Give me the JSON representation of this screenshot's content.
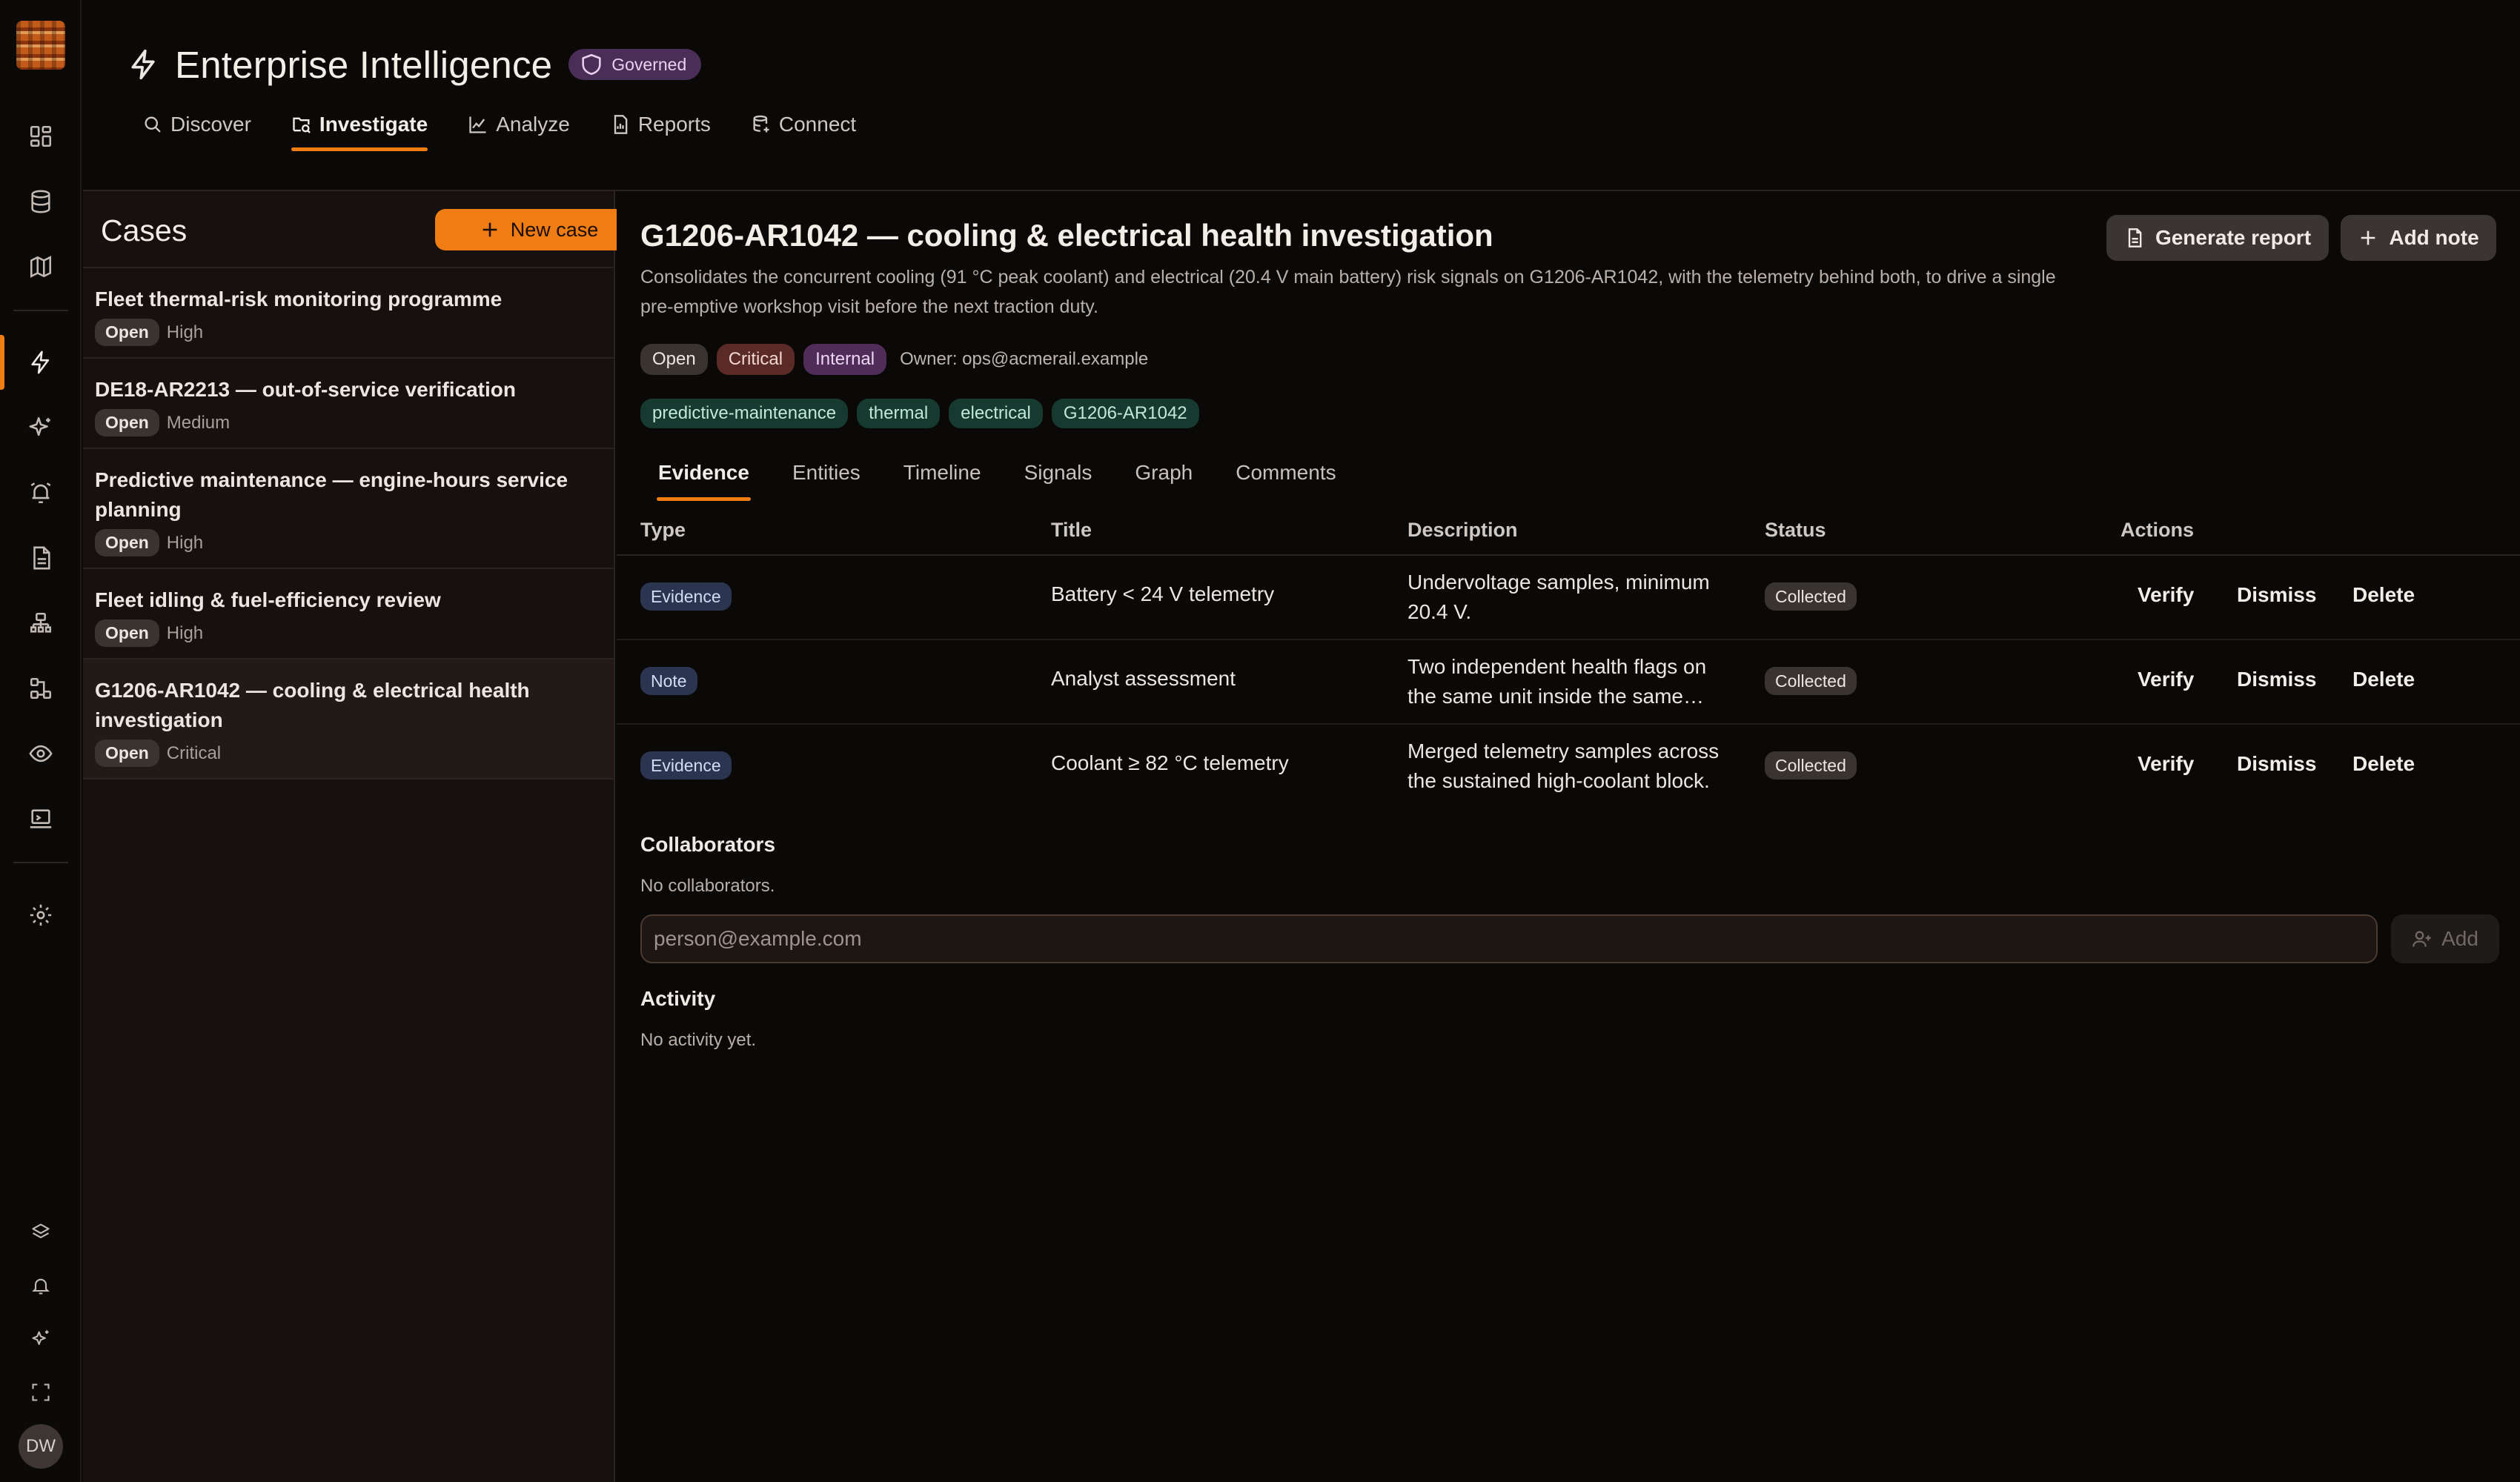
{
  "app": {
    "title": "Enterprise Intelligence",
    "governed_badge": "Governed",
    "avatar_initials": "DW"
  },
  "colors": {
    "accent": "#f07d14",
    "background": "#0a0908",
    "sidebar": "#16110e",
    "critical": "#5a2a26",
    "internal": "#4f2d58",
    "tag": "#163a30",
    "evidence_type": "#2c3550"
  },
  "rail": {
    "icons": [
      "dashboard-icon",
      "database-icon",
      "map-icon",
      "bolt-icon",
      "sparkle-icon",
      "alarm-icon",
      "document-icon",
      "org-chart-icon",
      "workflow-icon",
      "eye-icon",
      "terminal-icon",
      "settings-icon",
      "layers-icon",
      "bell-icon",
      "sparkles-icon",
      "fullscreen-icon"
    ],
    "active": "bolt-icon"
  },
  "nav": {
    "items": [
      {
        "label": "Discover",
        "icon": "search-icon"
      },
      {
        "label": "Investigate",
        "icon": "folder-search-icon",
        "active": true
      },
      {
        "label": "Analyze",
        "icon": "chart-icon"
      },
      {
        "label": "Reports",
        "icon": "report-icon"
      },
      {
        "label": "Connect",
        "icon": "database-link-icon"
      }
    ]
  },
  "cases": {
    "title": "Cases",
    "new_case_label": "New case",
    "items": [
      {
        "title": "Fleet thermal-risk monitoring programme",
        "status": "Open",
        "priority": "High"
      },
      {
        "title": "DE18-AR2213 — out-of-service verification",
        "status": "Open",
        "priority": "Medium"
      },
      {
        "title": "Predictive maintenance — engine-hours service planning",
        "status": "Open",
        "priority": "High"
      },
      {
        "title": "Fleet idling & fuel-efficiency review",
        "status": "Open",
        "priority": "High"
      },
      {
        "title": "G1206-AR1042 — cooling & electrical health investigation",
        "status": "Open",
        "priority": "Critical"
      }
    ]
  },
  "case": {
    "title": "G1206-AR1042 — cooling & electrical health investigation",
    "description": "Consolidates the concurrent cooling (91 °C peak coolant) and electrical (20.4 V main battery) risk signals on G1206-AR1042, with the telemetry behind both, to drive a single pre-emptive workshop visit before the next traction duty.",
    "generate_report_label": "Generate report",
    "add_note_label": "Add note",
    "status": "Open",
    "severity": "Critical",
    "classification": "Internal",
    "owner": "Owner: ops@acmerail.example",
    "tags": [
      "predictive-maintenance",
      "thermal",
      "electrical",
      "G1206-AR1042"
    ]
  },
  "tabs": [
    "Evidence",
    "Entities",
    "Timeline",
    "Signals",
    "Graph",
    "Comments"
  ],
  "evidence": {
    "columns": [
      "Type",
      "Title",
      "Description",
      "Status",
      "Actions"
    ],
    "rows": [
      {
        "type": "Evidence",
        "title": "Battery < 24 V telemetry",
        "description": "Undervoltage samples, minimum 20.4 V.",
        "status": "Collected"
      },
      {
        "type": "Note",
        "title": "Analyst assessment",
        "description": "Two independent health flags on the same unit inside the same…",
        "status": "Collected"
      },
      {
        "type": "Evidence",
        "title": "Coolant ≥ 82 °C telemetry",
        "description": "Merged telemetry samples across the sustained high-coolant block.",
        "status": "Collected"
      }
    ],
    "actions": {
      "verify": "Verify",
      "dismiss": "Dismiss",
      "delete": "Delete"
    }
  },
  "collaborators": {
    "title": "Collaborators",
    "empty": "No collaborators.",
    "input_placeholder": "person@example.com",
    "add_label": "Add"
  },
  "activity": {
    "title": "Activity",
    "empty": "No activity yet."
  }
}
